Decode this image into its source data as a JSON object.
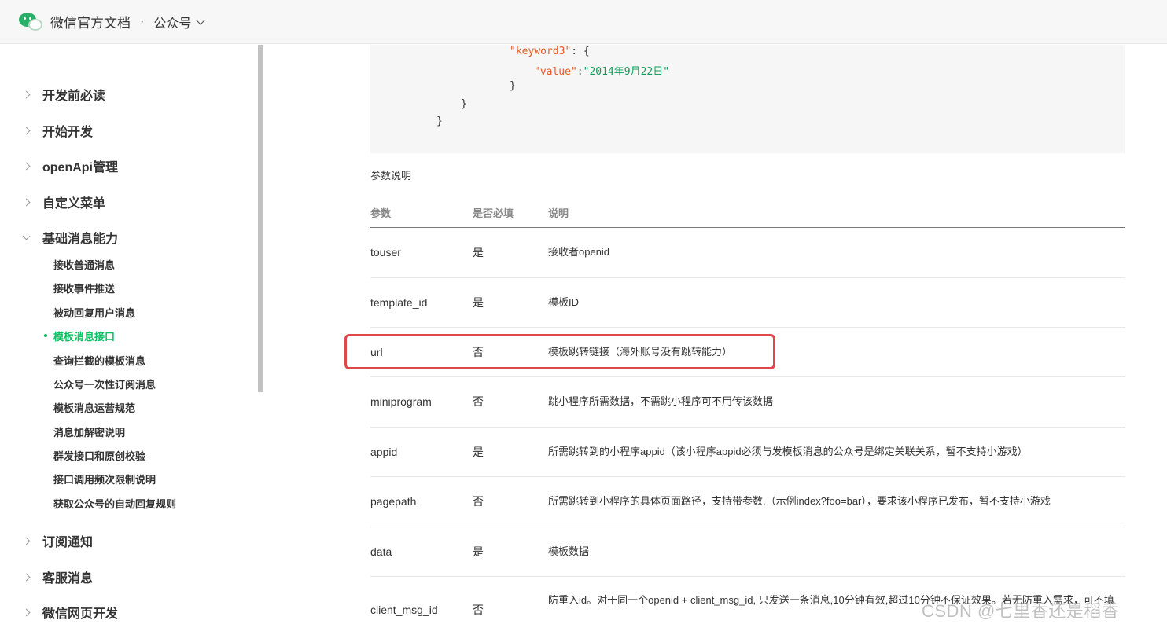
{
  "header": {
    "brand": "微信官方文档",
    "separator": "·",
    "section": "公众号"
  },
  "sidebar": {
    "groups_top": [
      {
        "label": "开发前必读"
      },
      {
        "label": "开始开发"
      },
      {
        "label": "openApi管理"
      },
      {
        "label": "自定义菜单"
      },
      {
        "label": "基础消息能力"
      }
    ],
    "sub_items": [
      {
        "label": "接收普通消息"
      },
      {
        "label": "接收事件推送"
      },
      {
        "label": "被动回复用户消息"
      },
      {
        "label": "模板消息接口",
        "active": true
      },
      {
        "label": "查询拦截的模板消息"
      },
      {
        "label": "公众号一次性订阅消息"
      },
      {
        "label": "模板消息运营规范"
      },
      {
        "label": "消息加解密说明"
      },
      {
        "label": "群发接口和原创校验"
      },
      {
        "label": "接口调用频次限制说明"
      },
      {
        "label": "获取公众号的自动回复规则"
      }
    ],
    "groups_bottom": [
      {
        "label": "订阅通知"
      },
      {
        "label": "客服消息"
      },
      {
        "label": "微信网页开发"
      }
    ]
  },
  "code": {
    "line1_key": "\"keyword3\"",
    "line1_rest": ": {",
    "line2_key": "\"value\"",
    "line2_colon": ":",
    "line2_val": "\"2014年9月22日\"",
    "line3": "}",
    "line4": "}",
    "line5": "}"
  },
  "params": {
    "title": "参数说明",
    "columns": [
      "参数",
      "是否必填",
      "说明"
    ],
    "rows": [
      {
        "name": "touser",
        "required": "是",
        "desc": "接收者openid"
      },
      {
        "name": "template_id",
        "required": "是",
        "desc": "模板ID"
      },
      {
        "name": "url",
        "required": "否",
        "desc": "模板跳转链接（海外账号没有跳转能力）"
      },
      {
        "name": "miniprogram",
        "required": "否",
        "desc": "跳小程序所需数据，不需跳小程序可不用传该数据"
      },
      {
        "name": "appid",
        "required": "是",
        "desc": "所需跳转到的小程序appid（该小程序appid必须与发模板消息的公众号是绑定关联关系，暂不支持小游戏）"
      },
      {
        "name": "pagepath",
        "required": "否",
        "desc": "所需跳转到小程序的具体页面路径，支持带参数,（示例index?foo=bar），要求该小程序已发布，暂不支持小游戏"
      },
      {
        "name": "data",
        "required": "是",
        "desc": "模板数据"
      },
      {
        "name": "client_msg_id",
        "required": "否",
        "desc": "防重入id。对于同一个openid + client_msg_id, 只发送一条消息,10分钟有效,超过10分钟不保证效果。若无防重入需求，可不填"
      }
    ]
  },
  "watermark": "CSDN @七里香还是稻香",
  "colors": {
    "accent": "#07c160",
    "highlight_border": "#e0474b",
    "code_key": "#e85826",
    "code_string": "#0f9d58"
  }
}
